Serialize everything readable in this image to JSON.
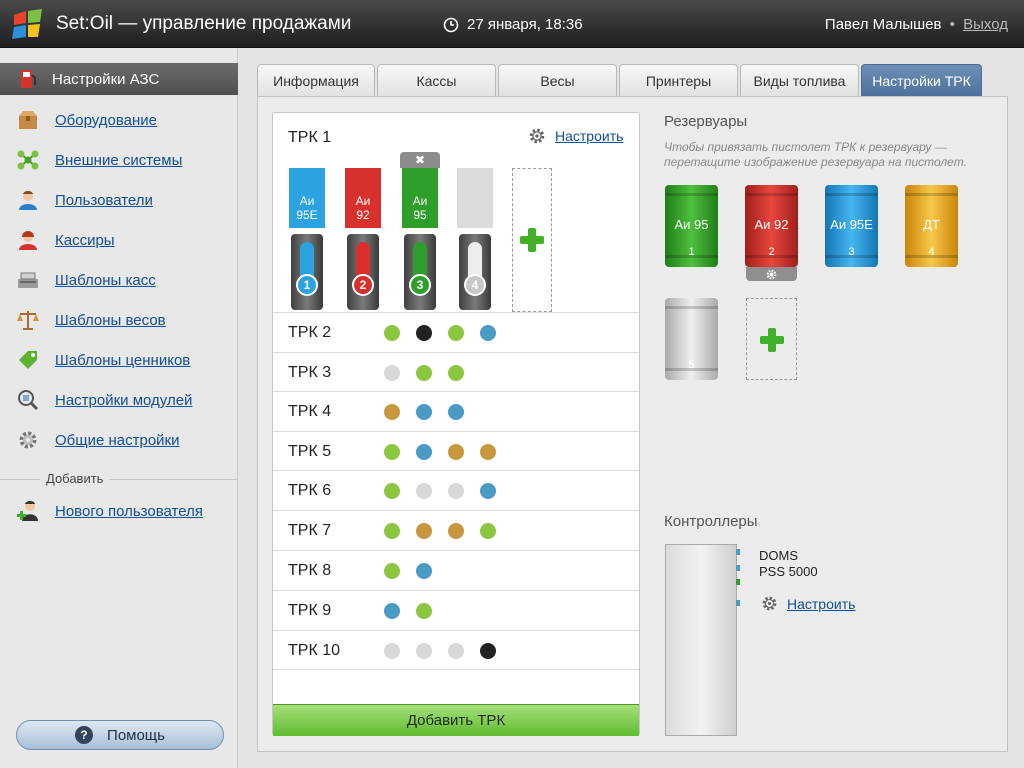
{
  "header": {
    "app_title": "Set:Oil — управление продажами",
    "datetime": "27 января, 18:36",
    "user_name": "Павел Малышев",
    "separator": "•",
    "logout_label": "Выход"
  },
  "sidebar": {
    "active_label": "Настройки АЗС",
    "items": [
      {
        "label": "Оборудование",
        "icon": "box-icon"
      },
      {
        "label": "Внешние системы",
        "icon": "network-icon"
      },
      {
        "label": "Пользователи",
        "icon": "user-icon"
      },
      {
        "label": "Кассиры",
        "icon": "cashier-icon"
      },
      {
        "label": "Шаблоны касс",
        "icon": "register-icon"
      },
      {
        "label": "Шаблоны весов",
        "icon": "scales-icon"
      },
      {
        "label": "Шаблоны ценников",
        "icon": "price-tag-icon"
      },
      {
        "label": "Настройки модулей",
        "icon": "module-icon"
      },
      {
        "label": "Общие настройки",
        "icon": "gear-icon"
      }
    ],
    "add_section_label": "Добавить",
    "add_user_label": "Нового пользователя",
    "help_label": "Помощь"
  },
  "tabs": [
    "Информация",
    "Кассы",
    "Весы",
    "Принтеры",
    "Виды топлива",
    "Настройки ТРК"
  ],
  "active_tab": "Настройки ТРК",
  "trk_panel": {
    "first_trk": {
      "title": "ТРК 1",
      "configure_label": "Настроить",
      "nozzles": [
        {
          "fuel": "Аи",
          "grade": "95Е",
          "number": "1",
          "color": "#2ba3e0"
        },
        {
          "fuel": "Аи",
          "grade": "92",
          "number": "2",
          "color": "#d8302c"
        },
        {
          "fuel": "Аи",
          "grade": "95",
          "number": "3",
          "color": "#2e9f2a"
        },
        {
          "fuel": "",
          "grade": "",
          "number": "4",
          "color": "#d9d9d9"
        }
      ],
      "remove_symbol": "✖"
    },
    "rows": [
      {
        "name": "ТРК 2",
        "dots": [
          "#8cc63f",
          "#222222",
          "#8cc63f",
          "#4a9bc4"
        ]
      },
      {
        "name": "ТРК 3",
        "dots": [
          "#d8d8d8",
          "#8cc63f",
          "#8cc63f"
        ]
      },
      {
        "name": "ТРК 4",
        "dots": [
          "#c8963e",
          "#4a9bc4",
          "#4a9bc4"
        ]
      },
      {
        "name": "ТРК 5",
        "dots": [
          "#8cc63f",
          "#4a9bc4",
          "#c8963e",
          "#c8963e"
        ]
      },
      {
        "name": "ТРК 6",
        "dots": [
          "#8cc63f",
          "#d8d8d8",
          "#d8d8d8",
          "#4a9bc4"
        ]
      },
      {
        "name": "ТРК 7",
        "dots": [
          "#8cc63f",
          "#c8963e",
          "#c8963e",
          "#8cc63f"
        ]
      },
      {
        "name": "ТРК 8",
        "dots": [
          "#8cc63f",
          "#4a9bc4"
        ]
      },
      {
        "name": "ТРК 9",
        "dots": [
          "#4a9bc4",
          "#8cc63f"
        ]
      },
      {
        "name": "ТРК 10",
        "dots": [
          "#d8d8d8",
          "#d8d8d8",
          "#d8d8d8",
          "#222222"
        ]
      }
    ],
    "add_trk_label": "Добавить ТРК"
  },
  "reservoirs": {
    "title": "Резервуары",
    "hint": "Чтобы привязать пистолет ТРК к резервуару — перетащите изображение резервуара на пистолет.",
    "items": [
      {
        "name": "Аи 95",
        "id": "1",
        "color": "#2f9e25"
      },
      {
        "name": "Аи 92",
        "id": "2",
        "color": "#d23029"
      },
      {
        "name": "Аи 95Е",
        "id": "3",
        "color": "#2a9be0"
      },
      {
        "name": "ДТ",
        "id": "4",
        "color": "#e9ab12"
      },
      {
        "name": "",
        "id": "5",
        "color": "#d9d9d9"
      }
    ]
  },
  "controllers": {
    "title": "Контроллеры",
    "name_line1": "DOMS",
    "name_line2": "PSS 5000",
    "configure_label": "Настроить"
  }
}
